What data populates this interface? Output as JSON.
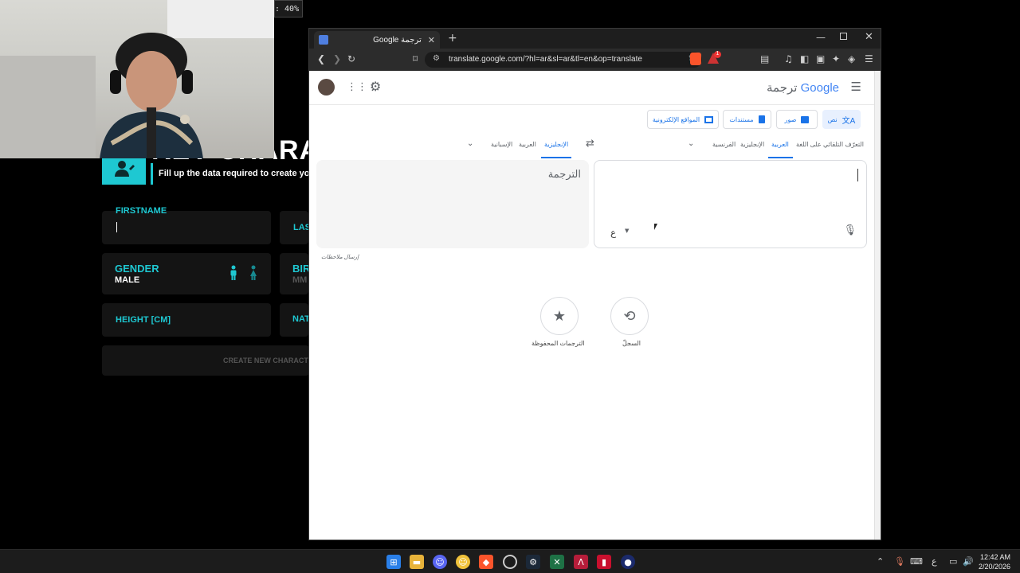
{
  "webcam": {
    "zoom": ": 40%"
  },
  "game": {
    "title": "REV CHARA",
    "subtitle": "Fill up the data required to create you",
    "fields": {
      "firstname_label": "FIRSTNAME",
      "lastname_label": "LAS",
      "gender_label": "GENDER",
      "gender_value": "MALE",
      "birth_label": "BIR",
      "birth_value": "MM",
      "height_label": "HEIGHT [CM]",
      "nat_label": "NAT"
    },
    "create_label": "CREATE NEW CHARACT"
  },
  "browser": {
    "tab_title": "Google ترجمة",
    "url": "translate.google.com/?hl=ar&sl=ar&tl=en&op=translate",
    "brave_badge": "1",
    "page": {
      "logo_google": "Google",
      "logo_suffix": "ترجمة",
      "modes": [
        {
          "label": "نص",
          "active": true
        },
        {
          "label": "صور",
          "active": false
        },
        {
          "label": "مستندات",
          "active": false
        },
        {
          "label": "المواقع الإلكترونية",
          "active": false
        }
      ],
      "source_langs": [
        "التعرّف التلقائي على اللغة",
        "العربية",
        "الإنجليزية",
        "الفرنسية"
      ],
      "target_langs": [
        "الإنجليزية",
        "العربية",
        "الإسبانية"
      ],
      "keyboard_glyph": "ع",
      "target_placeholder": "الترجمة",
      "feedback": "إرسال ملاحظات",
      "history_label": "السجلّ",
      "saved_label": "الترجمات المحفوظة"
    }
  },
  "taskbar": {
    "time": "12:42 AM",
    "date": "2/20/2026",
    "input_lang": "ع"
  },
  "colors": {
    "accent_cyan": "#1ec8d2",
    "google_blue": "#1a73e8"
  }
}
